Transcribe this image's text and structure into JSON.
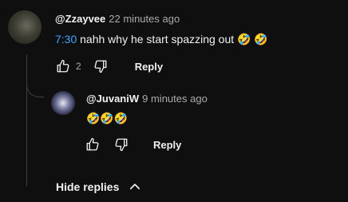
{
  "comment": {
    "author": "@Zzayvee",
    "time": "22 minutes ago",
    "timestamp_link": "7:30",
    "text": "nahh why he start spazzing out 🤣 🤣",
    "likes": "2",
    "reply_label": "Reply"
  },
  "reply": {
    "author": "@JuvaniW",
    "time": "9 minutes ago",
    "text": "🤣🤣🤣",
    "reply_label": "Reply"
  },
  "hide_replies_label": "Hide replies",
  "icons": {
    "like": "thumb-up-icon",
    "dislike": "thumb-down-icon",
    "collapse": "chevron-up-icon"
  },
  "colors": {
    "background": "#0f0f0f",
    "text": "#f1f1f1",
    "secondary_text": "#aaaaaa",
    "link": "#3ea6ff"
  }
}
